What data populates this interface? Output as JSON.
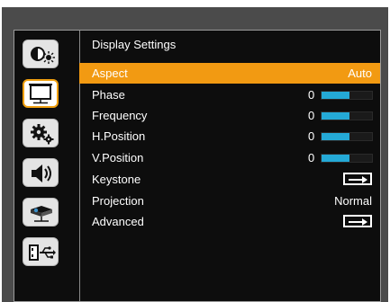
{
  "menu": {
    "title": "Display Settings",
    "rows": [
      {
        "label": "Aspect",
        "value": "Auto"
      },
      {
        "label": "Phase",
        "value": "0",
        "level": 0.55
      },
      {
        "label": "Frequency",
        "value": "0",
        "level": 0.55
      },
      {
        "label": "H.Position",
        "value": "0",
        "level": 0.55
      },
      {
        "label": "V.Position",
        "value": "0",
        "level": 0.55
      },
      {
        "label": "Keystone",
        "action": "enter-arrow-icon"
      },
      {
        "label": "Projection",
        "value": "Normal"
      },
      {
        "label": "Advanced",
        "action": "enter-arrow-icon"
      }
    ]
  },
  "sidebar": {
    "tabs": [
      {
        "icon": "contrast-brightness-icon"
      },
      {
        "icon": "display-screen-icon",
        "active": true
      },
      {
        "icon": "gears-settings-icon"
      },
      {
        "icon": "speaker-volume-icon"
      },
      {
        "icon": "projector-icon"
      },
      {
        "icon": "usb-icon"
      }
    ]
  },
  "colors": {
    "highlight": "#f29a12",
    "level_fill": "#24a9d6",
    "panel_bg": "#0d0d0d",
    "frame_bg": "#4b4b4b"
  }
}
